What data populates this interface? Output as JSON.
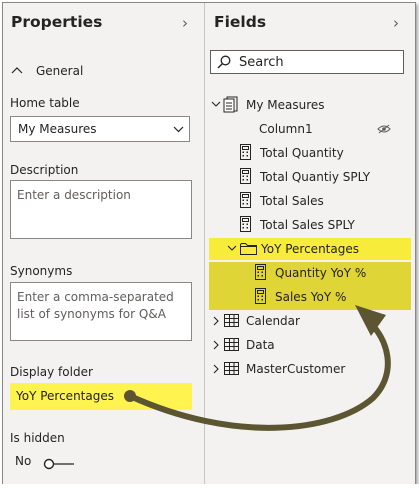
{
  "properties": {
    "title": "Properties",
    "section": "General",
    "home_table_label": "Home table",
    "home_table_value": "My Measures",
    "description_label": "Description",
    "description_placeholder": "Enter a description",
    "synonyms_label": "Synonyms",
    "synonyms_placeholder": "Enter a comma-separated list of synonyms for Q&A",
    "display_folder_label": "Display folder",
    "display_folder_value": "YoY Percentages",
    "is_hidden_label": "Is hidden",
    "is_hidden_value": "No"
  },
  "fields": {
    "title": "Fields",
    "search_placeholder": "Search",
    "tables": [
      {
        "name": "My Measures",
        "expanded": true
      },
      {
        "name": "Calendar",
        "expanded": false
      },
      {
        "name": "Data",
        "expanded": false
      },
      {
        "name": "MasterCustomer",
        "expanded": false
      }
    ],
    "my_measures_items": [
      "Column1",
      "Total Quantity",
      "Total Quantiy SPLY",
      "Total Sales",
      "Total Sales SPLY"
    ],
    "folder": {
      "name": "YoY Percentages",
      "items": [
        "Quantity YoY %",
        "Sales YoY %"
      ]
    }
  },
  "colors": {
    "highlight": "#fff34f",
    "arrow": "#5b5532",
    "panel": "#f3f2f1"
  }
}
